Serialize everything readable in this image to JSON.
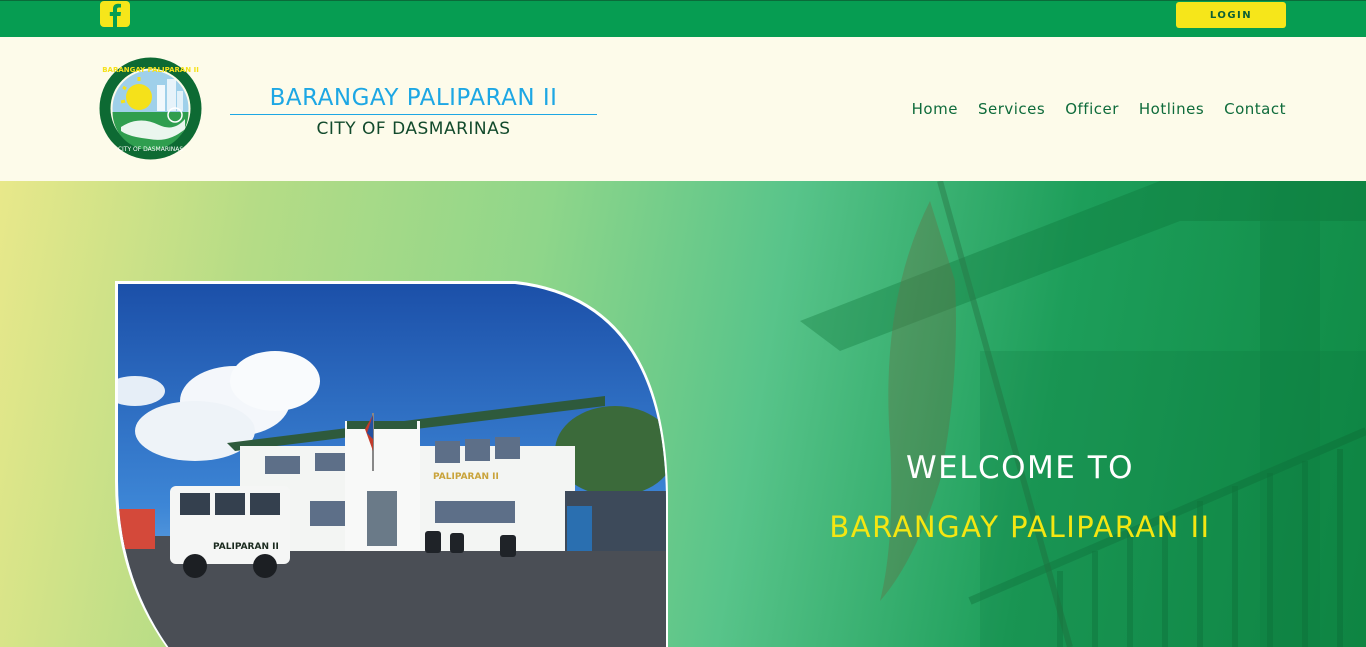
{
  "topbar": {
    "social_icon": "facebook-icon",
    "login_label": "LOGIN"
  },
  "header": {
    "logo_icon": "barangay-seal-logo",
    "brand_title": "BARANGAY PALIPARAN II",
    "brand_subtitle": "CITY OF DASMARINAS",
    "nav": [
      {
        "label": "Home"
      },
      {
        "label": "Services"
      },
      {
        "label": "Officer"
      },
      {
        "label": "Hotlines"
      },
      {
        "label": "Contact"
      }
    ]
  },
  "hero": {
    "line1": "WELCOME TO",
    "line2": "BARANGAY PALIPARAN II"
  },
  "colors": {
    "topbar_green": "#069d52",
    "login_yellow": "#f6e61a",
    "brand_blue": "#1da7e4",
    "nav_green": "#0e6b3b",
    "welcome_yellow": "#f4e612"
  }
}
